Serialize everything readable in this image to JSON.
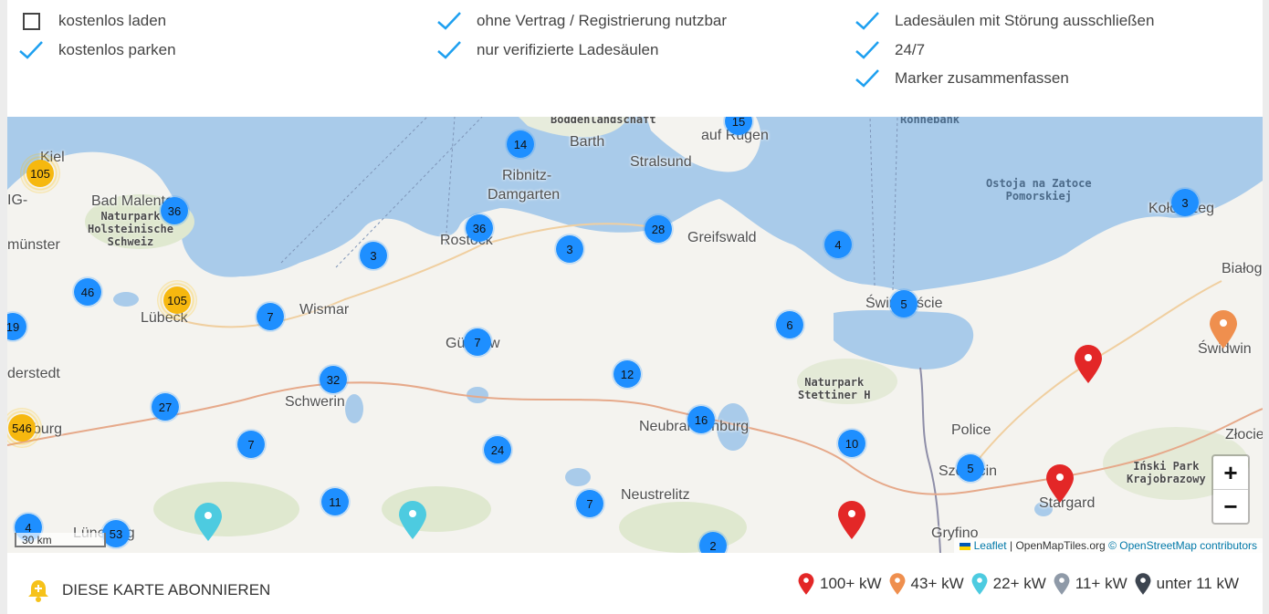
{
  "filters": [
    {
      "label": "kostenlos laden",
      "checked": false
    },
    {
      "label": "kostenlos parken",
      "checked": true
    },
    {
      "label": "ohne Vertrag / Registrierung nutzbar",
      "checked": true
    },
    {
      "label": "nur verifizierte Ladesäulen",
      "checked": true
    },
    {
      "label": "Ladesäulen mit Störung ausschließen",
      "checked": true
    },
    {
      "label": "24/7",
      "checked": true
    },
    {
      "label": "Marker zusammenfassen",
      "checked": true
    }
  ],
  "map": {
    "places": [
      "Kiel",
      "Bad Malente",
      "münster",
      "Lübeck",
      "Wismar",
      "Rostock",
      "Ribnitz-",
      "Damgarten",
      "Barth",
      "Stralsund",
      "auf Rügen",
      "Greifswald",
      "Świnoujście",
      "Güstrow",
      "Schwerin",
      "derstedt",
      "burg",
      "Neubrandenburg",
      "Neustrelitz",
      "Police",
      "Szczecin",
      "Stargard",
      "Gryfino",
      "Świdwin",
      "Białogard",
      "Złocieniec",
      "Kołobrzeg",
      "IG-",
      "Lüneburg"
    ],
    "parks": [
      "Naturpark\nHolsteinische\nSchweiz",
      "Naturpark\nStettiner H",
      "Iński Park\nKrajobrazowy",
      "Boddenlandschaft",
      "Ronnebank"
    ],
    "water_labels": [
      "Ostoja na Zatoce\nPomorskiej"
    ],
    "clusters": [
      "105",
      "36",
      "46",
      "105",
      "19",
      "546",
      "27",
      "7",
      "7",
      "3",
      "32",
      "11",
      "53",
      "4",
      "36",
      "14",
      "15",
      "3",
      "7",
      "28",
      "24",
      "7",
      "12",
      "16",
      "6",
      "4",
      "5",
      "10",
      "5",
      "3",
      "2"
    ],
    "zoom_in": "+",
    "zoom_out": "−",
    "scale": "30 km",
    "attribution": {
      "leaflet": "Leaflet",
      "sep": "|",
      "tiles": "OpenMapTiles.org",
      "osm": "© OpenStreetMap contributors"
    }
  },
  "subscribe": {
    "label": "DIESE KARTE ABONNIEREN"
  },
  "legend": [
    {
      "label": "100+ kW",
      "color": "#e32727"
    },
    {
      "label": "43+ kW",
      "color": "#ef8f4e"
    },
    {
      "label": "22+ kW",
      "color": "#4dcbe0"
    },
    {
      "label": "11+ kW",
      "color": "#8f9aa8"
    },
    {
      "label": "unter 11 kW",
      "color": "#3d4550"
    }
  ],
  "colors": {
    "cluster": "#1e8fff",
    "cluster_big": "#f6b80f",
    "check": "#1ea0f0",
    "water": "#a9cbea",
    "bell": "#f6c21a"
  }
}
